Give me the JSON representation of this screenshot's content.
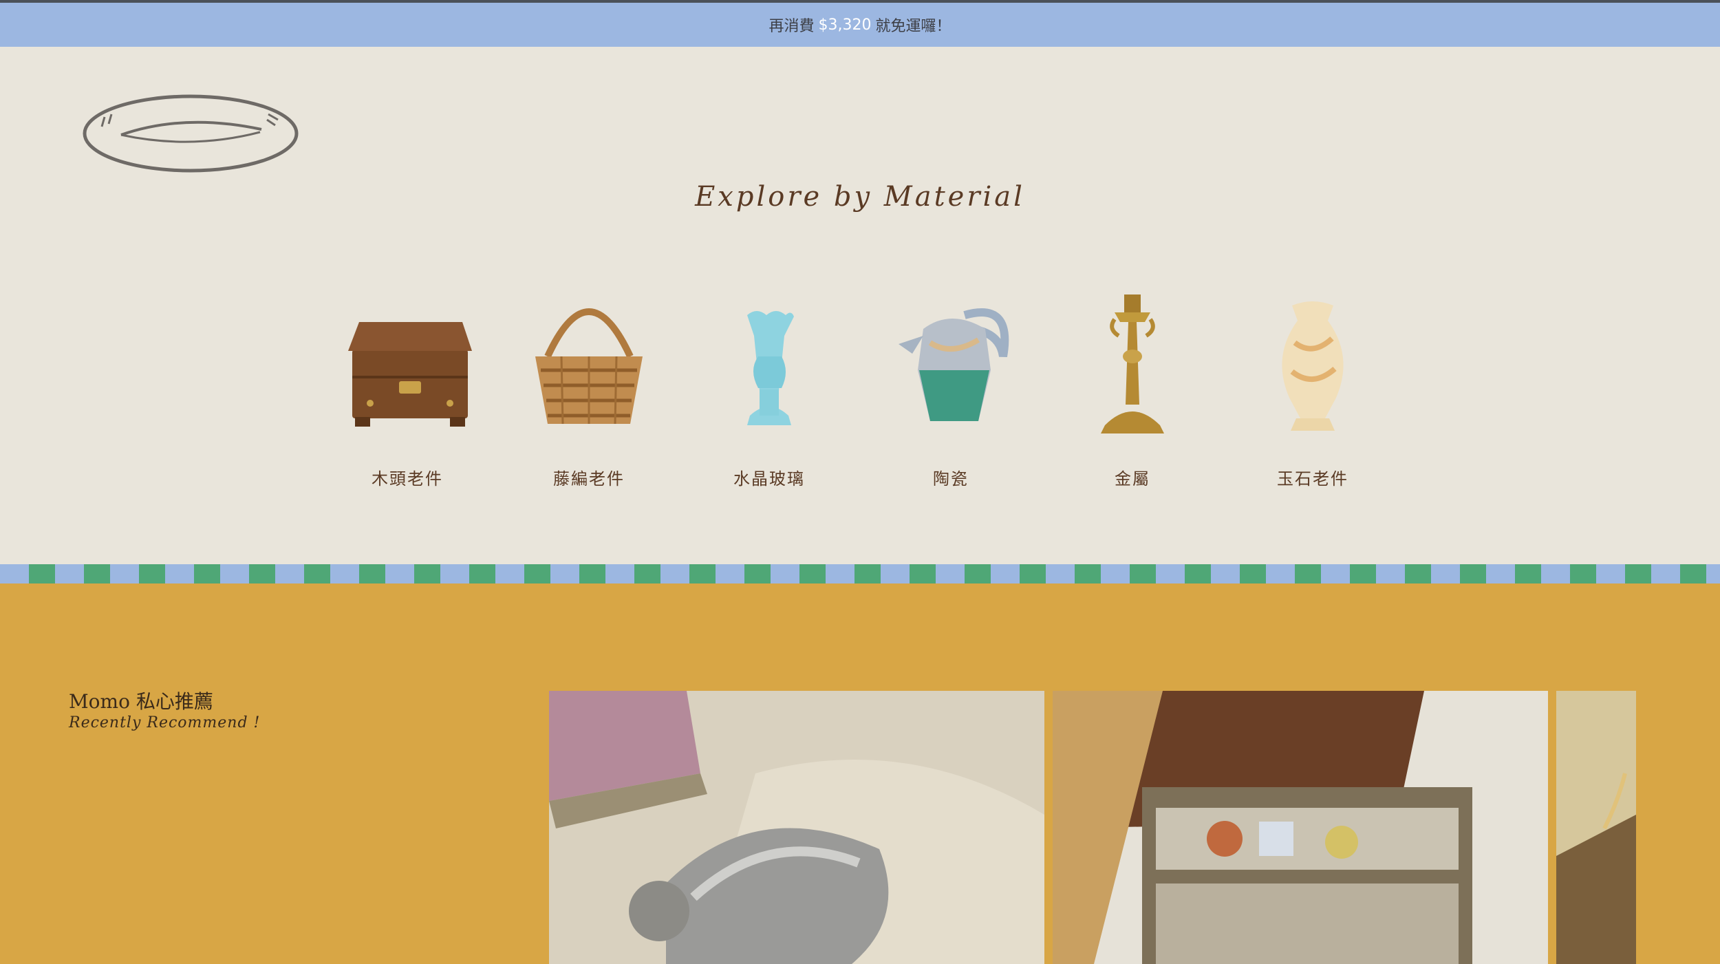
{
  "promo": {
    "prefix": "再消費",
    "amount": "$3,320",
    "suffix": "就免運囉！"
  },
  "header": {
    "logo_icon": "plate-logo-icon"
  },
  "materials_section": {
    "title": "Explore by Material",
    "items": [
      {
        "label": "木頭老件",
        "icon": "wooden-box-icon"
      },
      {
        "label": "藤編老件",
        "icon": "wicker-basket-icon"
      },
      {
        "label": "水晶玻璃",
        "icon": "glass-hand-vase-icon"
      },
      {
        "label": "陶瓷",
        "icon": "ceramic-pitcher-icon"
      },
      {
        "label": "金屬",
        "icon": "brass-candlestick-icon"
      },
      {
        "label": "玉石老件",
        "icon": "onyx-vase-icon"
      }
    ]
  },
  "recommend": {
    "title": "Momo 私心推薦",
    "subtitle": "Recently Recommend !",
    "cards": [
      {
        "image": "silver-dish-photo"
      },
      {
        "image": "wooden-shelf-photo"
      },
      {
        "image": "wheat-photo"
      }
    ]
  },
  "colors": {
    "promo_bg": "#9cb7e1",
    "header_bg": "#e9e5db",
    "stripe_blue": "#9cb7e1",
    "stripe_green": "#4fa776",
    "recommend_bg": "#d8a645",
    "title_brown": "#5a3a24"
  }
}
